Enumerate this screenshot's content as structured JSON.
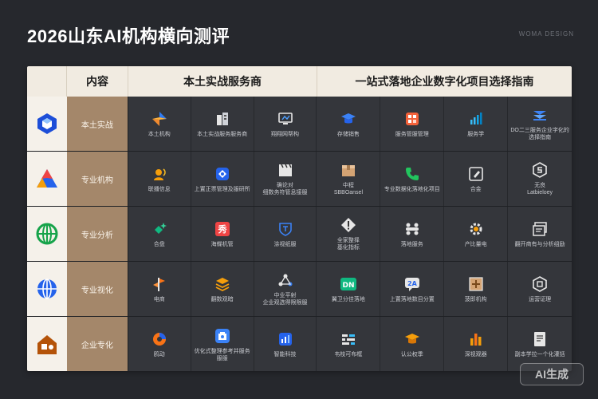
{
  "title": "2026山东AI机构横向测评",
  "watermark_top": "WOMA DESIGN",
  "header": {
    "content": "内容",
    "local": "本土实战服务商",
    "guide": "一站式落地企业数字化项目选择指南"
  },
  "rows": [
    {
      "category": "本土实战",
      "cells": [
        {
          "label": "本土机构",
          "icon": "arrow-logo-icon"
        },
        {
          "label": "本土实战服务服务商",
          "icon": "building-icon"
        },
        {
          "label": "翔翔网帮构",
          "icon": "monitor-icon"
        },
        {
          "label": "存储销售",
          "icon": "graduation-cap-icon"
        },
        {
          "label": "服务管服管理",
          "icon": "grid-app-icon"
        },
        {
          "label": "服务学",
          "icon": "signal-icon"
        },
        {
          "label": "DO二三服务企业字化的选择指南",
          "icon": "double-chevron-icon"
        }
      ]
    },
    {
      "category": "专业机构",
      "cells": [
        {
          "label": "联播信息",
          "icon": "person-signal-icon"
        },
        {
          "label": "上置正票管理及服研所",
          "icon": "diamond-eye-icon"
        },
        {
          "label": "确论对\n细数务符管息接服",
          "icon": "clapper-icon"
        },
        {
          "label": "中程\nSBBOansel",
          "icon": "box-icon"
        },
        {
          "label": "专业数据化落地化项目",
          "icon": "phone-icon"
        },
        {
          "label": "合金",
          "icon": "pen-square-icon"
        },
        {
          "label": "无良\nLatbieloey",
          "icon": "hexagon-s-icon"
        }
      ]
    },
    {
      "category": "专业分析",
      "cells": [
        {
          "label": "合盘",
          "icon": "star-diamond-icon"
        },
        {
          "label": "海蝶机管",
          "icon": "red-badge-icon"
        },
        {
          "label": "涂视纸服",
          "icon": "shield-icon"
        },
        {
          "label": "全家整择\n基化指标",
          "icon": "exclaim-diamond-icon"
        },
        {
          "label": "落地服务",
          "icon": "nodes-icon"
        },
        {
          "label": "产比量电",
          "icon": "gear-icon"
        },
        {
          "label": "翻开商有与分析组励",
          "icon": "cards-icon"
        }
      ]
    },
    {
      "category": "专业视化",
      "cells": [
        {
          "label": "电商",
          "icon": "flag-icon"
        },
        {
          "label": "翻数观暗",
          "icon": "layers-icon"
        },
        {
          "label": "中业平射\n企业观选得限限服",
          "icon": "molecule-icon"
        },
        {
          "label": "翼卫分佳落地",
          "icon": "dn-icon"
        },
        {
          "label": "上置落地数目分置",
          "icon": "chat-2a-icon"
        },
        {
          "label": "菠即机构",
          "icon": "plus-square-icon"
        },
        {
          "label": "运营证理",
          "icon": "hex-box-icon"
        }
      ]
    },
    {
      "category": "企业专化",
      "cells": [
        {
          "label": "鸥动",
          "icon": "swirl-icon"
        },
        {
          "label": "优化式整理参考并服务服服",
          "icon": "camera-icon"
        },
        {
          "label": "智能科技",
          "icon": "chart-doc-icon"
        },
        {
          "label": "韦枝可布框",
          "icon": "eq-icon"
        },
        {
          "label": "认公权季",
          "icon": "mortarboard-icon"
        },
        {
          "label": "深视观器",
          "icon": "bars-icon"
        },
        {
          "label": "副本学拉一个化灌括",
          "icon": "document-icon"
        }
      ]
    }
  ],
  "row_logos": [
    "blue-cube-logo",
    "a-mountain-logo",
    "green-globe-logo",
    "blue-globe-logo",
    "orange-house-logo"
  ],
  "ai_badge": "AI生成",
  "colors": {
    "background": "#26282d",
    "header_bg": "#f1ebe1",
    "category_bg": "#a4876a",
    "cell_bg": "#34363b"
  }
}
